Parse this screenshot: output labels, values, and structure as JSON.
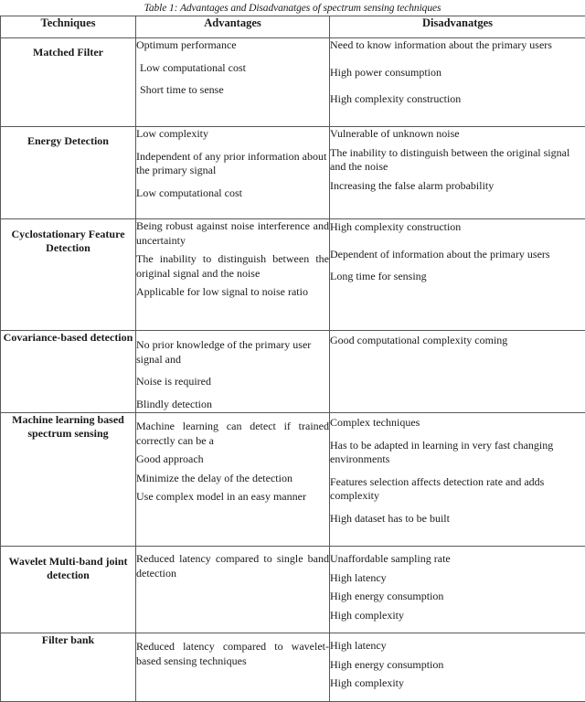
{
  "caption": "Table 1: Advantages and Disadvanatges of spectrum sensing techniques",
  "headers": {
    "techniques": "Techniques",
    "advantages": "Advantages",
    "disadvantages": "Disadvanatges"
  },
  "rows": [
    {
      "technique": "Matched Filter",
      "advantages": [
        "Optimum performance",
        "Low computational cost",
        "Short time to sense"
      ],
      "disadvantages": [
        "Need to know information about the primary users",
        "High power consumption",
        "High complexity construction"
      ]
    },
    {
      "technique": "Energy Detection",
      "advantages": [
        "Low complexity",
        "Independent of any prior information about the primary signal",
        "Low computational cost"
      ],
      "disadvantages": [
        "Vulnerable of unknown noise",
        "The inability to distinguish between the original signal and the noise",
        "Increasing the false alarm probability"
      ]
    },
    {
      "technique": "Cyclostationary Feature Detection",
      "advantages": [
        "Being robust against noise interference and uncertainty",
        "The inability to distinguish between the original signal and the noise",
        "Applicable for low signal to noise ratio"
      ],
      "disadvantages": [
        "High complexity construction",
        "Dependent of information about the primary users",
        "Long time for sensing"
      ]
    },
    {
      "technique": "Covariance-based detection",
      "advantages": [
        "No prior knowledge of the primary user signal and",
        "Noise is required",
        "Blindly detection"
      ],
      "disadvantages": [
        "Good computational complexity coming"
      ]
    },
    {
      "technique": "Machine learning based spectrum sensing",
      "advantages": [
        "Machine learning can detect if trained correctly can be a",
        "Good approach",
        "Minimize the delay of the detection",
        "Use complex model in an easy manner"
      ],
      "disadvantages": [
        "Complex techniques",
        "Has to be adapted in learning in very fast changing environments",
        "Features selection affects detection rate and adds complexity",
        "High dataset has to be built"
      ]
    },
    {
      "technique": "Wavelet Multi-band joint detection",
      "advantages": [
        "Reduced latency compared to single band detection"
      ],
      "disadvantages": [
        "Unaffordable sampling rate",
        "High latency",
        "High energy consumption",
        "High complexity"
      ]
    },
    {
      "technique": "Filter bank",
      "advantages": [
        "Reduced latency compared to wavelet-based sensing techniques"
      ],
      "disadvantages": [
        "High latency",
        "High energy consumption",
        "High complexity"
      ]
    }
  ]
}
